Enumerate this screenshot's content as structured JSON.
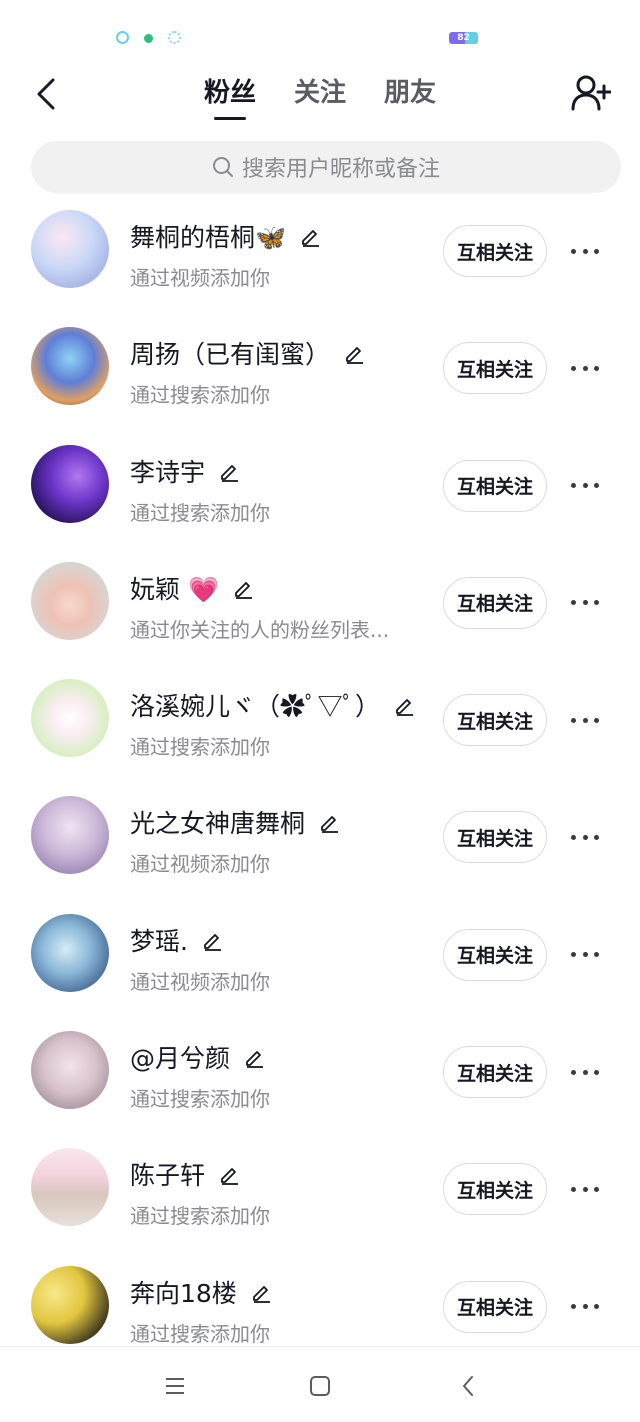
{
  "status_bar": {
    "icons": [
      "location-icon",
      "wechat-icon",
      "wifi-icon"
    ],
    "battery_level": "82"
  },
  "nav": {
    "tabs": [
      {
        "label": "粉丝",
        "active": true
      },
      {
        "label": "关注",
        "active": false
      },
      {
        "label": "朋友",
        "active": false
      }
    ]
  },
  "search": {
    "placeholder": "搜索用户昵称或备注"
  },
  "followers": [
    {
      "name": "舞桐的梧桐🦋",
      "source": "通过视频添加你",
      "button": "互相关注"
    },
    {
      "name": "周扬（已有闺蜜）",
      "source": "通过搜索添加你",
      "button": "互相关注"
    },
    {
      "name": "李诗宇",
      "source": "通过搜索添加你",
      "button": "互相关注"
    },
    {
      "name": "妧颖 💗",
      "source": "通过你关注的人的粉丝列表...",
      "button": "互相关注"
    },
    {
      "name": "洛溪婉儿ヾ（✿ﾟ▽ﾟ）",
      "source": "通过搜索添加你",
      "button": "互相关注"
    },
    {
      "name": "光之女神唐舞桐",
      "source": "通过视频添加你",
      "button": "互相关注"
    },
    {
      "name": "梦瑶.",
      "source": "通过视频添加你",
      "button": "互相关注"
    },
    {
      "name": "@月兮颜",
      "source": "通过搜索添加你",
      "button": "互相关注"
    },
    {
      "name": "陈子轩",
      "source": "通过搜索添加你",
      "button": "互相关注"
    },
    {
      "name": "奔向18楼",
      "source": "通过搜索添加你",
      "button": "互相关注"
    }
  ],
  "colors": {
    "text_primary": "#161823",
    "text_secondary": "#8a8b91",
    "search_bg": "#f1f1f2",
    "button_border": "#dcdcdf"
  }
}
